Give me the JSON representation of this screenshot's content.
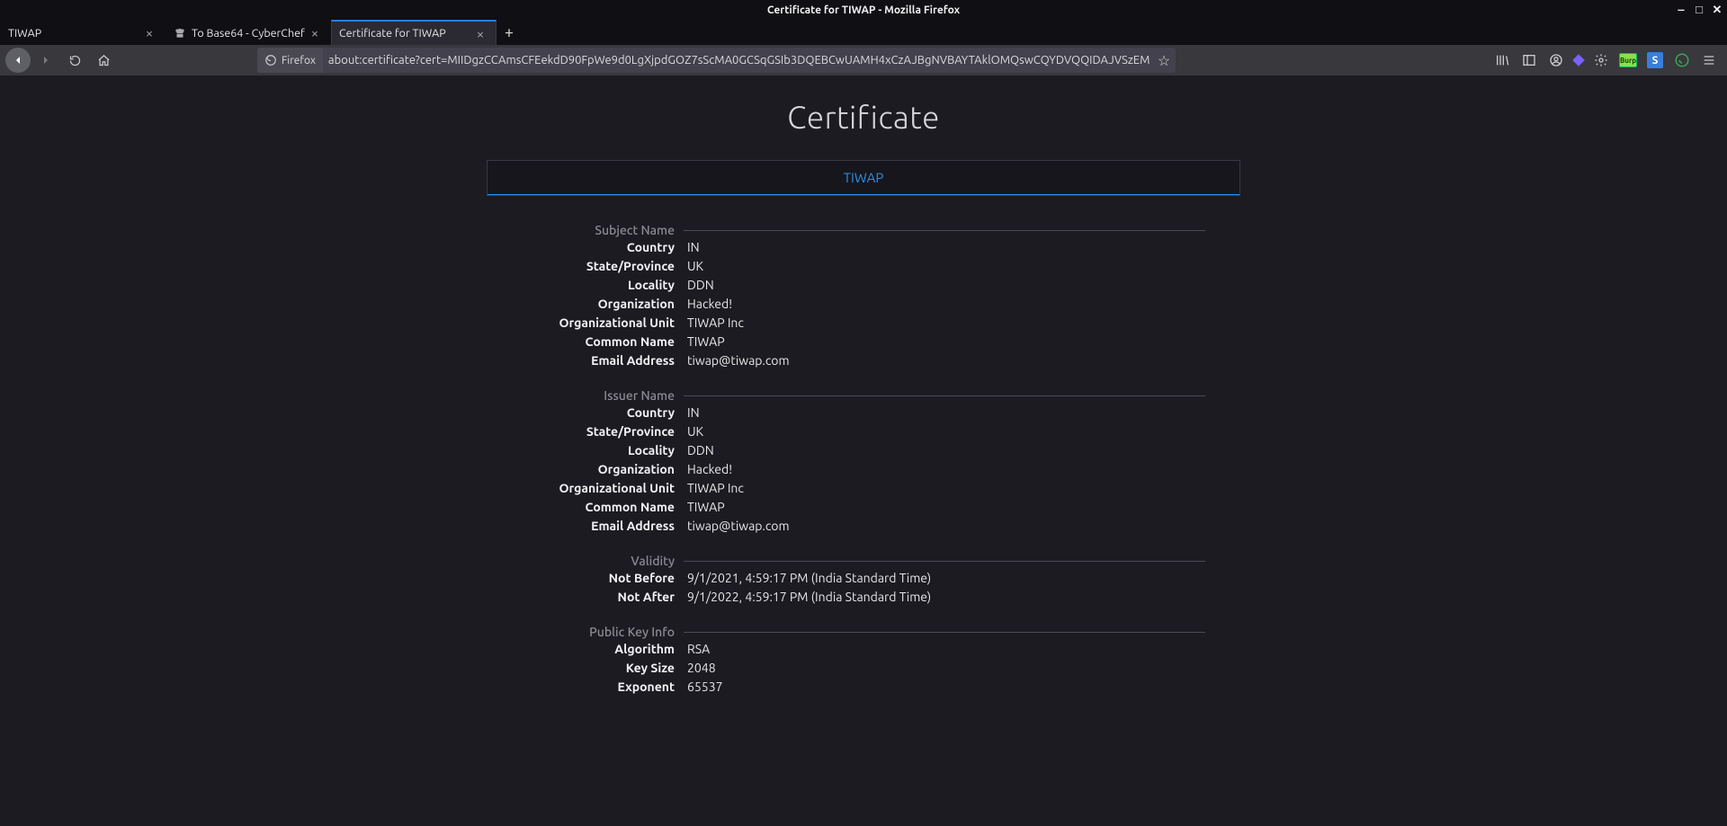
{
  "window": {
    "title": "Certificate for TIWAP - Mozilla Firefox"
  },
  "tabs": [
    {
      "label": "TIWAP",
      "active": false
    },
    {
      "label": "To Base64 - CyberChef",
      "active": false
    },
    {
      "label": "Certificate for TIWAP",
      "active": true
    }
  ],
  "urlbar": {
    "identity_label": "Firefox",
    "address": "about:certificate?cert=MIIDgzCCAmsCFEekdD90FpWe9d0LgXjpdGOZ7sScMA0GCSqGSIb3DQEBCwUAMH4xCzAJBgNVBAYTAklOMQswCQYDVQQIDAJVSzEM"
  },
  "page": {
    "title": "Certificate",
    "tab_label": "TIWAP",
    "sections": [
      {
        "title": "Subject Name",
        "rows": [
          {
            "k": "Country",
            "v": "IN"
          },
          {
            "k": "State/Province",
            "v": "UK"
          },
          {
            "k": "Locality",
            "v": "DDN"
          },
          {
            "k": "Organization",
            "v": "Hacked!"
          },
          {
            "k": "Organizational Unit",
            "v": "TIWAP Inc"
          },
          {
            "k": "Common Name",
            "v": "TIWAP"
          },
          {
            "k": "Email Address",
            "v": "tiwap@tiwap.com"
          }
        ]
      },
      {
        "title": "Issuer Name",
        "rows": [
          {
            "k": "Country",
            "v": "IN"
          },
          {
            "k": "State/Province",
            "v": "UK"
          },
          {
            "k": "Locality",
            "v": "DDN"
          },
          {
            "k": "Organization",
            "v": "Hacked!"
          },
          {
            "k": "Organizational Unit",
            "v": "TIWAP Inc"
          },
          {
            "k": "Common Name",
            "v": "TIWAP"
          },
          {
            "k": "Email Address",
            "v": "tiwap@tiwap.com"
          }
        ]
      },
      {
        "title": "Validity",
        "rows": [
          {
            "k": "Not Before",
            "v": "9/1/2021, 4:59:17 PM (India Standard Time)"
          },
          {
            "k": "Not After",
            "v": "9/1/2022, 4:59:17 PM (India Standard Time)"
          }
        ]
      },
      {
        "title": "Public Key Info",
        "rows": [
          {
            "k": "Algorithm",
            "v": "RSA"
          },
          {
            "k": "Key Size",
            "v": "2048"
          },
          {
            "k": "Exponent",
            "v": "65537"
          }
        ]
      }
    ]
  }
}
